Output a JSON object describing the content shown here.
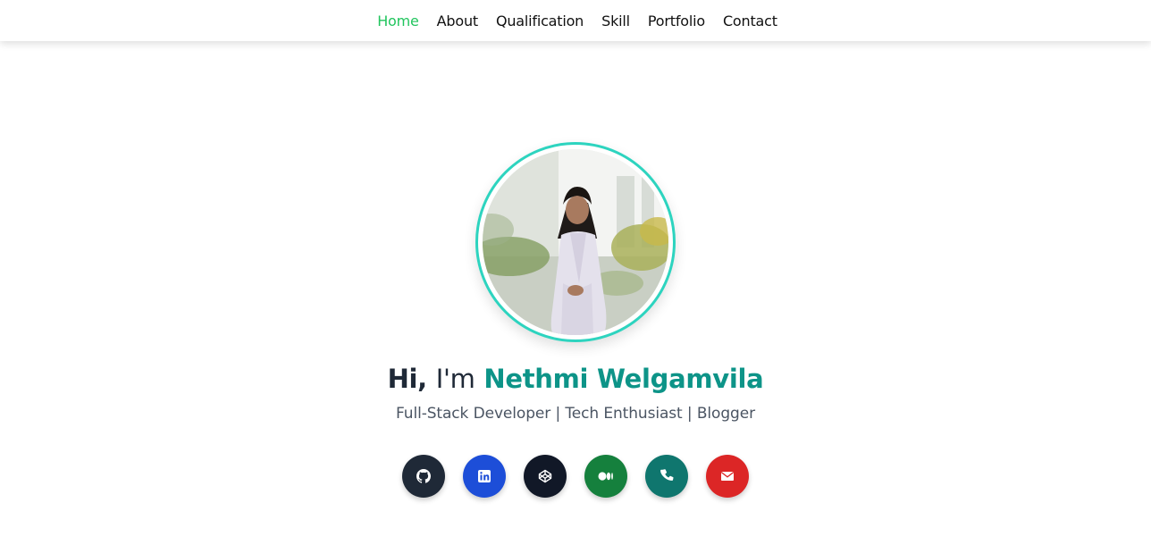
{
  "nav": {
    "items": [
      {
        "label": "Home",
        "active": true
      },
      {
        "label": "About"
      },
      {
        "label": "Qualification"
      },
      {
        "label": "Skill"
      },
      {
        "label": "Portfolio"
      },
      {
        "label": "Contact"
      }
    ]
  },
  "hero": {
    "greeting_hi": "Hi,",
    "greeting_im": "I'm",
    "name": "Nethmi Welgamvila",
    "tagline": "Full-Stack Developer | Tech Enthusiast | Blogger",
    "profile_photo": "profile-photo"
  },
  "socials": [
    {
      "icon": "github-icon",
      "color": "#1f2937"
    },
    {
      "icon": "linkedin-icon",
      "color": "#1d4ed8"
    },
    {
      "icon": "codepen-icon",
      "color": "#111827"
    },
    {
      "icon": "medium-icon",
      "color": "#15803d"
    },
    {
      "icon": "phone-icon",
      "color": "#0f766e"
    },
    {
      "icon": "email-icon",
      "color": "#dc2626"
    }
  ],
  "colors": {
    "accent_green": "#22c55e",
    "name_teal": "#0d9488",
    "ring_teal": "#2dd4bf"
  }
}
